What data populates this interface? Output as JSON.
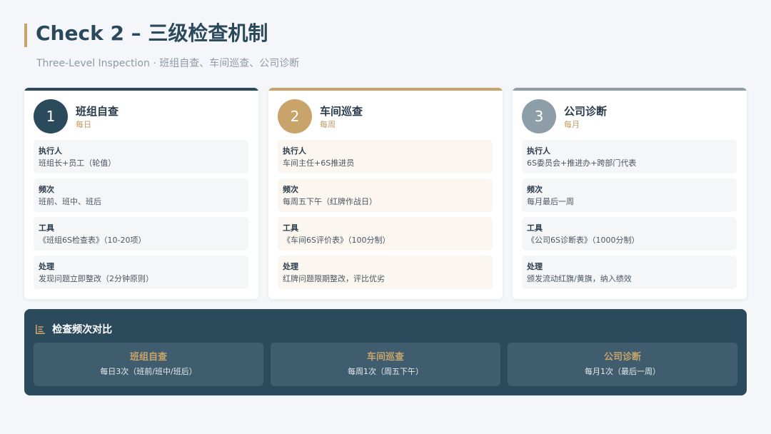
{
  "title": "Check 2 – 三级检查机制",
  "subtitle": "Three-Level Inspection · 班组自查、车间巡查、公司诊断",
  "colors": {
    "accent_gold": "#c9a46a",
    "level1": "#2b4a5c",
    "level2": "#c9a46a",
    "level3": "#8d9ea9",
    "panel_bg": "#2b4a5c"
  },
  "cards": [
    {
      "number": "1",
      "title": "班组自查",
      "frequency": "每日",
      "rows": [
        {
          "label": "执行人",
          "value": "班组长+员工（轮值）"
        },
        {
          "label": "频次",
          "value": "班前、班中、班后"
        },
        {
          "label": "工具",
          "value": "《班组6S检查表》（10-20项）"
        },
        {
          "label": "处理",
          "value": "发现问题立即整改（2分钟原则）"
        }
      ]
    },
    {
      "number": "2",
      "title": "车间巡查",
      "frequency": "每周",
      "rows": [
        {
          "label": "执行人",
          "value": "车间主任+6S推进员"
        },
        {
          "label": "频次",
          "value": "每周五下午（红牌作战日）"
        },
        {
          "label": "工具",
          "value": "《车间6S评价表》（100分制）"
        },
        {
          "label": "处理",
          "value": "红牌问题限期整改，评比优劣"
        }
      ]
    },
    {
      "number": "3",
      "title": "公司诊断",
      "frequency": "每月",
      "rows": [
        {
          "label": "执行人",
          "value": "6S委员会+推进办+跨部门代表"
        },
        {
          "label": "频次",
          "value": "每月最后一周"
        },
        {
          "label": "工具",
          "value": "《公司6S诊断表》（1000分制）"
        },
        {
          "label": "处理",
          "value": "颁发流动红旗/黄旗，纳入绩效"
        }
      ]
    }
  ],
  "comparison": {
    "icon": "list-icon",
    "title": "检查频次对比",
    "items": [
      {
        "name": "班组自查",
        "value": "每日3次（班前/班中/班后）"
      },
      {
        "name": "车间巡查",
        "value": "每周1次（周五下午）"
      },
      {
        "name": "公司诊断",
        "value": "每月1次（最后一周）"
      }
    ]
  }
}
